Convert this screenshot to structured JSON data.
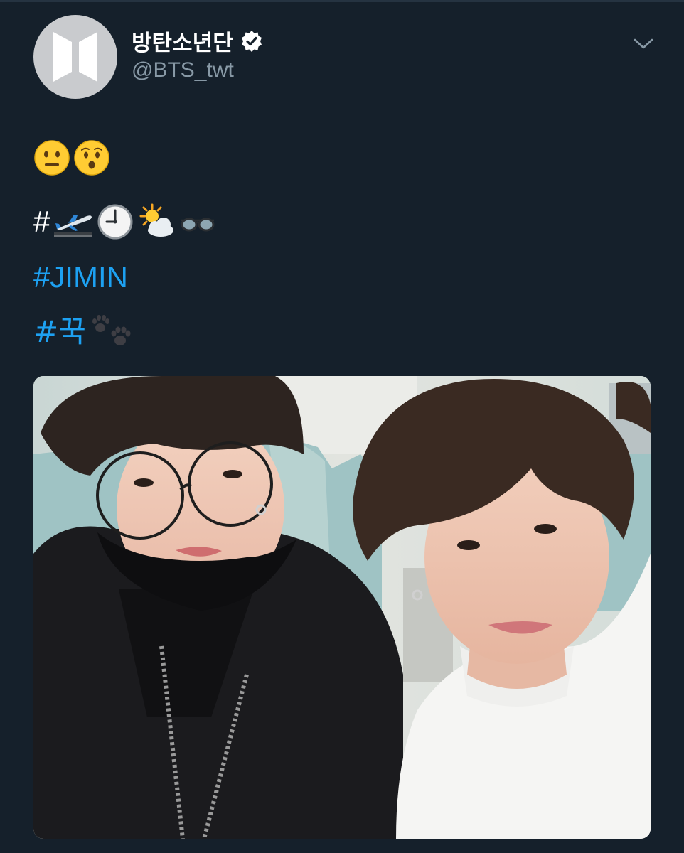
{
  "tweet": {
    "author": {
      "display_name": "방탄소년단",
      "handle": "@BTS_twt",
      "verified": true,
      "avatar_icon": "bts-logo-icon"
    },
    "menu_icon": "chevron-down-icon",
    "lines": [
      {
        "type": "emoji",
        "emojis": [
          "neutral-face-emoji",
          "hushed-face-emoji"
        ]
      },
      {
        "type": "hashtag-emoji",
        "hash": "#",
        "emojis": [
          "airplane-departure-emoji",
          "clock-emoji",
          "sun-behind-cloud-emoji",
          "glasses-emoji"
        ]
      },
      {
        "type": "hashtag",
        "text": "#JIMIN"
      },
      {
        "type": "hashtag",
        "text": "#꾹",
        "emojis": [
          "paw-prints-emoji"
        ]
      }
    ],
    "media": {
      "type": "photo",
      "subject": "two-person-selfie-on-airplane"
    }
  },
  "colors": {
    "background": "#15202b",
    "link": "#1da1f2",
    "secondary_text": "#8899a6",
    "avatar_bg": "#c9cbce"
  },
  "hashtags": {
    "hash_plain": "#",
    "jimin": "#JIMIN",
    "kook": "#꾹"
  }
}
